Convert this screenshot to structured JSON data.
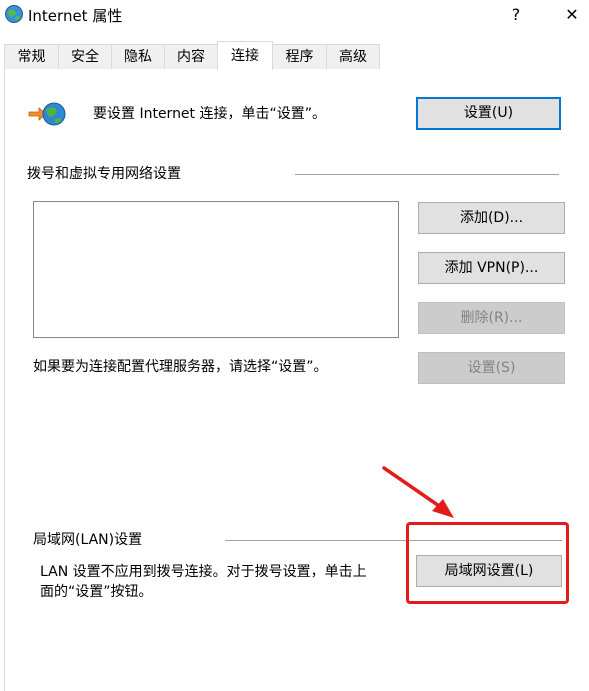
{
  "window": {
    "title": "Internet 属性",
    "help_glyph": "?",
    "close_glyph": "✕"
  },
  "tabs": [
    {
      "label": "常规"
    },
    {
      "label": "安全"
    },
    {
      "label": "隐私"
    },
    {
      "label": "内容"
    },
    {
      "label": "连接"
    },
    {
      "label": "程序"
    },
    {
      "label": "高级"
    }
  ],
  "setup": {
    "text": "要设置 Internet 连接，单击“设置”。",
    "button": "设置(U)"
  },
  "dialup": {
    "heading": "拨号和虚拟专用网络设置",
    "add_button": "添加(D)...",
    "add_vpn_button": "添加 VPN(P)...",
    "remove_button": "删除(R)...",
    "proxy_text": "如果要为连接配置代理服务器，请选择“设置”。",
    "settings_button": "设置(S)"
  },
  "lan": {
    "heading": "局域网(LAN)设置",
    "text_line1": "LAN 设置不应用到拨号连接。对于拨号设置，单击上",
    "text_line2": "面的“设置”按钮。",
    "button": "局域网设置(L)"
  },
  "annotation_color": "#e21b1b"
}
